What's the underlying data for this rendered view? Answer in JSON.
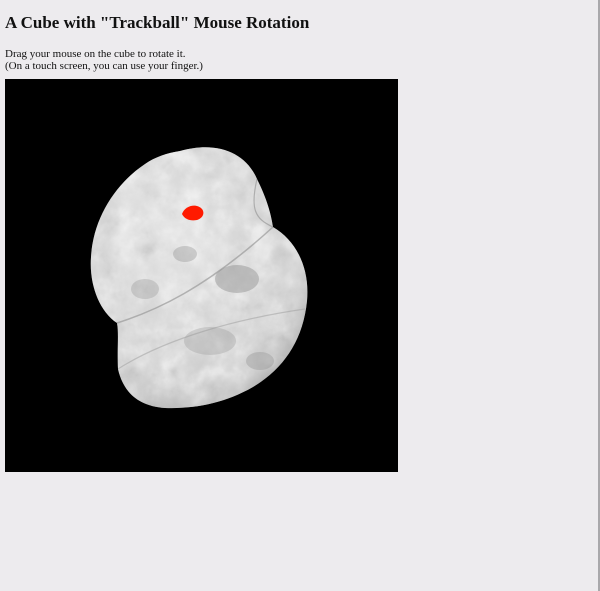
{
  "page": {
    "title": "A Cube with \"Trackball\" Mouse Rotation",
    "instructions": [
      "Drag your mouse on the cube to rotate it.",
      "(On a touch screen, you can use your finger.)"
    ]
  },
  "viewer": {
    "background_color": "#000000",
    "object_color": "#cfcfcf",
    "marker_color": "#ff1a00"
  }
}
